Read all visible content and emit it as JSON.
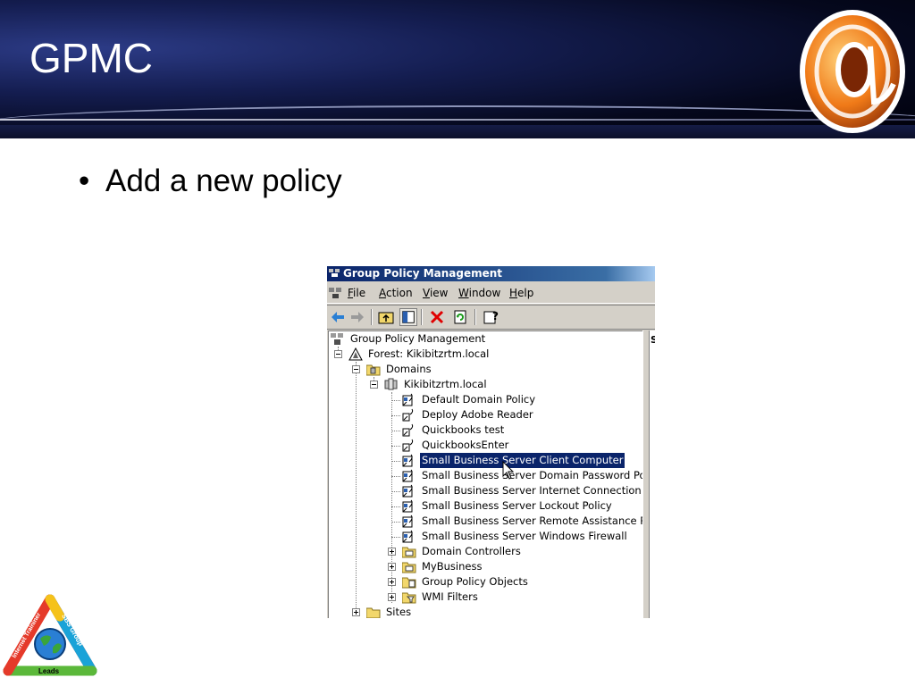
{
  "slide": {
    "title": "GPMC",
    "bullet": "Add a new policy"
  },
  "window": {
    "title": "Group Policy Management",
    "menu": [
      {
        "pre": "",
        "u": "F",
        "post": "ile"
      },
      {
        "pre": "",
        "u": "A",
        "post": "ction"
      },
      {
        "pre": "",
        "u": "V",
        "post": "iew"
      },
      {
        "pre": "",
        "u": "W",
        "post": "indow"
      },
      {
        "pre": "",
        "u": "H",
        "post": "elp"
      }
    ],
    "right_pane_fragment": "S",
    "tree": {
      "root": "Group Policy Management",
      "forest": "Forest: Kikibitzrtm.local",
      "domains": "Domains",
      "domain": "Kikibitzrtm.local",
      "gpo_links": [
        "Default Domain Policy",
        "Deploy Adobe Reader",
        "Quickbooks test",
        "QuickbooksEnter",
        "Small Business Server Client Computer",
        "Small Business Server Domain Password Policy",
        "Small Business Server Internet Connection Firew",
        "Small Business Server Lockout Policy",
        "Small Business Server Remote Assistance Policy",
        "Small Business Server Windows Firewall"
      ],
      "containers": [
        "Domain Controllers",
        "MyBusiness",
        "Group Policy Objects",
        "WMI Filters"
      ],
      "sites": "Sites"
    },
    "selected_index": 4
  },
  "logos": {
    "sbs_text_left": "Internet Traininer",
    "sbs_text_right": "SBS Group",
    "sbs_text_bottom": "Leads"
  },
  "colors": {
    "header_dark": "#05081d",
    "header_blue": "#2c3b86",
    "titlebar": "#0a246a",
    "selection": "#0a246a",
    "chrome": "#d4d0c8"
  }
}
